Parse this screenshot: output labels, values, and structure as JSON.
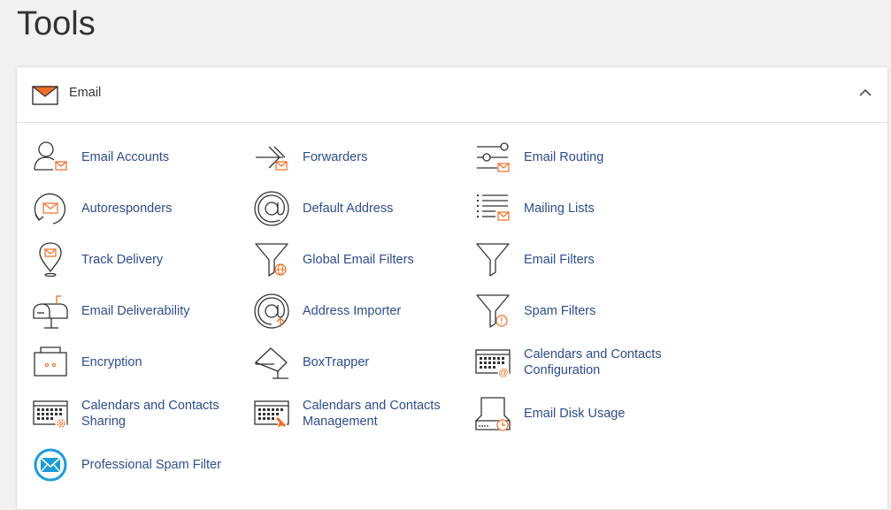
{
  "page": {
    "title": "Tools"
  },
  "panel": {
    "title": "Email"
  },
  "colors": {
    "link": "#2f4c8f",
    "accent": "#f26c23",
    "icon": "#333333",
    "spam_blue": "#1c9bd7"
  },
  "items": [
    {
      "label": "Email Accounts",
      "icon": "user-mail-icon"
    },
    {
      "label": "Forwarders",
      "icon": "forward-arrow-icon"
    },
    {
      "label": "Email Routing",
      "icon": "routing-icon"
    },
    {
      "label": "Autoresponders",
      "icon": "autoresponder-icon"
    },
    {
      "label": "Default Address",
      "icon": "at-sign-icon"
    },
    {
      "label": "Mailing Lists",
      "icon": "list-mail-icon"
    },
    {
      "label": "Track Delivery",
      "icon": "location-pin-icon"
    },
    {
      "label": "Global Email Filters",
      "icon": "funnel-globe-icon"
    },
    {
      "label": "Email Filters",
      "icon": "funnel-icon"
    },
    {
      "label": "Email Deliverability",
      "icon": "mailbox-icon"
    },
    {
      "label": "Address Importer",
      "icon": "at-import-icon"
    },
    {
      "label": "Spam Filters",
      "icon": "funnel-warning-icon"
    },
    {
      "label": "Encryption",
      "icon": "encryption-box-icon"
    },
    {
      "label": "BoxTrapper",
      "icon": "box-trap-icon"
    },
    {
      "label": "Calendars and Contacts Configuration",
      "icon": "calendar-at-icon"
    },
    {
      "label": "Calendars and Contacts Sharing",
      "icon": "calendar-gear-icon"
    },
    {
      "label": "Calendars and Contacts Management",
      "icon": "calendar-pencil-icon"
    },
    {
      "label": "Email Disk Usage",
      "icon": "disk-usage-icon"
    },
    {
      "label": "Professional Spam Filter",
      "icon": "spam-experts-icon"
    }
  ]
}
